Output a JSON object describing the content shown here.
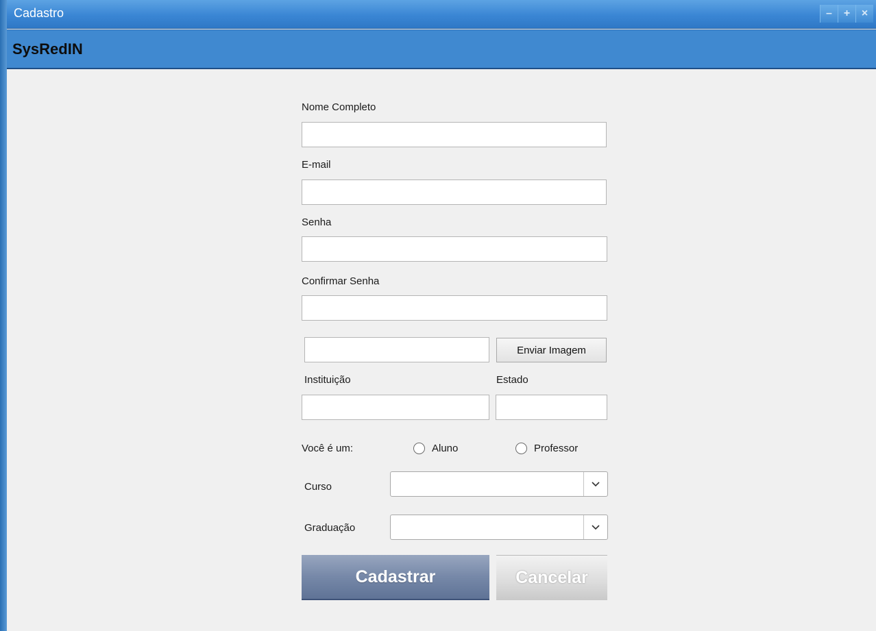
{
  "window": {
    "title": "Cadastro",
    "controls": {
      "minimize": "–",
      "maximize": "+",
      "close": "×"
    }
  },
  "header": {
    "app_title": "SysRedIN"
  },
  "form": {
    "nome": {
      "label": "Nome Completo",
      "value": ""
    },
    "email": {
      "label": "E-mail",
      "value": ""
    },
    "senha": {
      "label": "Senha",
      "value": ""
    },
    "confirmar_senha": {
      "label": "Confirmar Senha",
      "value": ""
    },
    "imagem": {
      "value": "",
      "button_label": "Enviar Imagem"
    },
    "instituicao": {
      "label": "Instituição",
      "value": ""
    },
    "estado": {
      "label": "Estado",
      "value": ""
    },
    "tipo": {
      "label": "Você é um:",
      "options": [
        {
          "label": "Aluno",
          "checked": false
        },
        {
          "label": "Professor",
          "checked": false
        }
      ]
    },
    "curso": {
      "label": "Curso",
      "selected": ""
    },
    "graduacao": {
      "label": "Graduação",
      "selected": ""
    }
  },
  "actions": {
    "submit_label": "Cadastrar",
    "cancel_label": "Cancelar"
  },
  "colors": {
    "titlebar": "#3a86d4",
    "header": "#4089d0",
    "background": "#f0f0f0",
    "primary_button": "#7688a8",
    "secondary_button": "#dcdcdc"
  },
  "icons": {
    "dropdown": "chevron-down-icon"
  }
}
